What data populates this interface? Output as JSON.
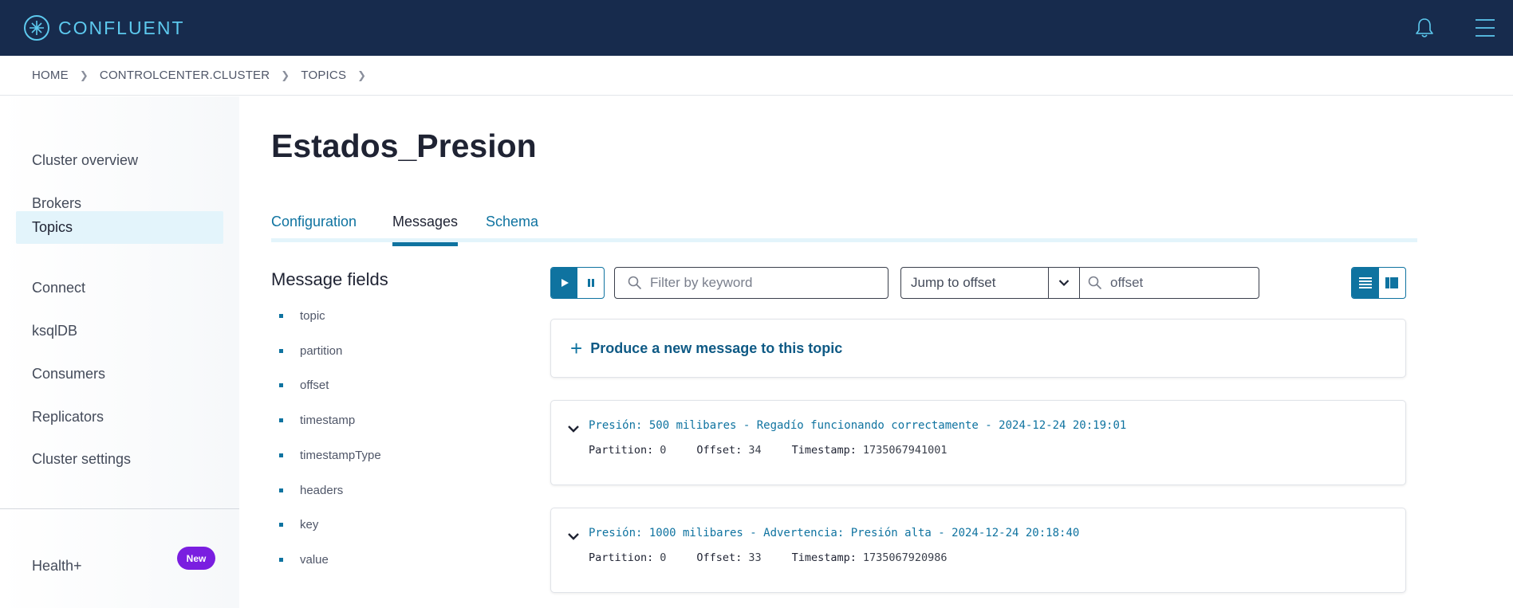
{
  "brand": {
    "name": "CONFLUENT",
    "accent": "#5dc9ee",
    "topbar_color": "#172b4d"
  },
  "breadcrumb": [
    "HOME",
    "CONTROLCENTER.CLUSTER",
    "TOPICS"
  ],
  "sidebar": {
    "items": [
      {
        "label": "Cluster overview",
        "active": false
      },
      {
        "label": "Brokers",
        "active": false
      },
      {
        "label": "Topics",
        "active": true
      },
      {
        "label": "Connect",
        "active": false
      },
      {
        "label": "ksqlDB",
        "active": false
      },
      {
        "label": "Consumers",
        "active": false
      },
      {
        "label": "Replicators",
        "active": false
      },
      {
        "label": "Cluster settings",
        "active": false
      }
    ],
    "health_label": "Health+",
    "health_badge": "New"
  },
  "page": {
    "title": "Estados_Presion",
    "tabs": [
      {
        "label": "Configuration",
        "active": false
      },
      {
        "label": "Messages",
        "active": true
      },
      {
        "label": "Schema",
        "active": false
      }
    ]
  },
  "message_fields": {
    "title": "Message fields",
    "items": [
      "topic",
      "partition",
      "offset",
      "timestamp",
      "timestampType",
      "headers",
      "key",
      "value"
    ]
  },
  "controls": {
    "filter_placeholder": "Filter by keyword",
    "jump_label": "Jump to offset",
    "offset_placeholder": "offset"
  },
  "produce_label": "Produce a new message to this topic",
  "meta_labels": {
    "partition": "Partition:",
    "offset": "Offset:",
    "timestamp": "Timestamp:"
  },
  "messages": [
    {
      "value": "Presión: 500 milibares - Regadío funcionando correctamente - 2024-12-24 20:19:01",
      "partition": "0",
      "offset": "34",
      "timestamp": "1735067941001"
    },
    {
      "value": "Presión: 1000 milibares - Advertencia: Presión alta - 2024-12-24 20:18:40",
      "partition": "0",
      "offset": "33",
      "timestamp": "1735067920986"
    }
  ]
}
